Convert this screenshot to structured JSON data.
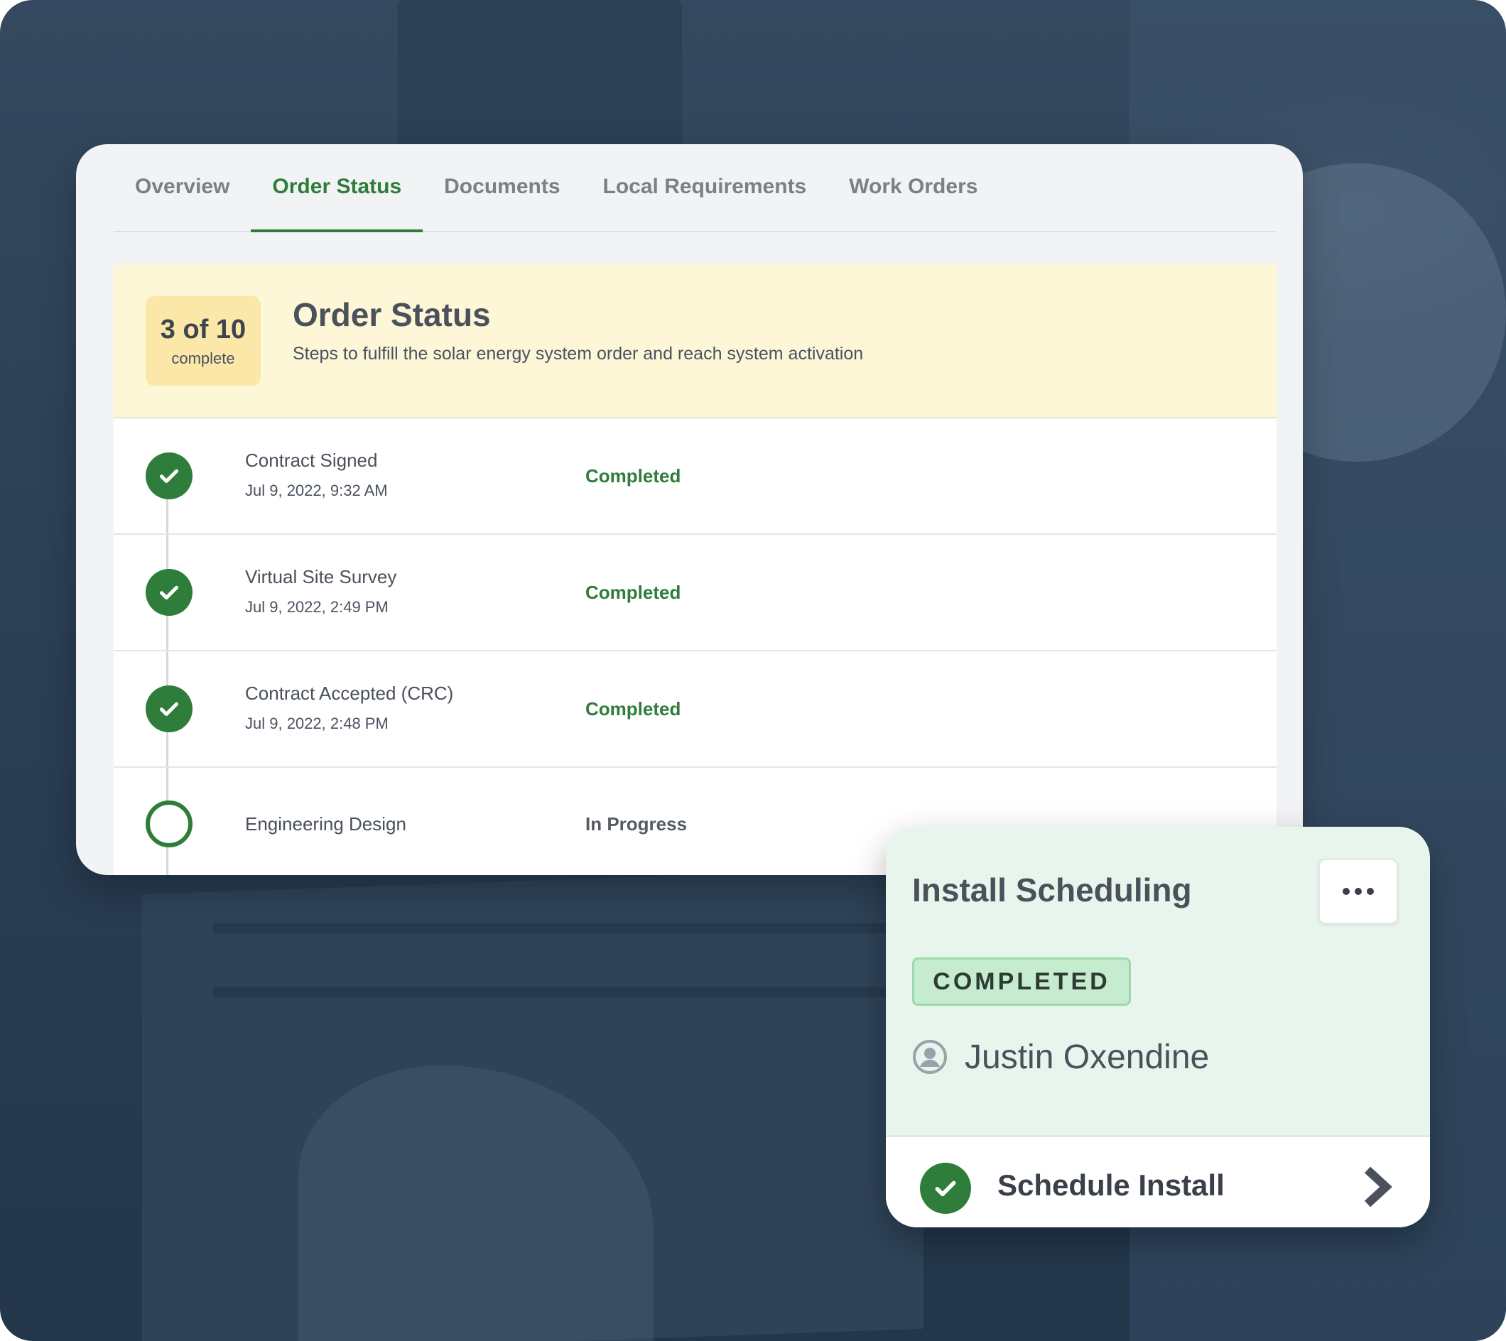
{
  "tabs": [
    {
      "label": "Overview",
      "active": false
    },
    {
      "label": "Order Status",
      "active": true
    },
    {
      "label": "Documents",
      "active": false
    },
    {
      "label": "Local Requirements",
      "active": false
    },
    {
      "label": "Work Orders",
      "active": false
    }
  ],
  "order_status": {
    "progress": {
      "count": "3 of 10",
      "label": "complete"
    },
    "title": "Order Status",
    "subtitle": "Steps to fulfill the solar energy system order and reach system activation"
  },
  "steps": [
    {
      "name": "Contract Signed",
      "date": "Jul 9, 2022, 9:32 AM",
      "status": "Completed",
      "icon": "check-circle-icon"
    },
    {
      "name": "Virtual Site Survey",
      "date": "Jul 9, 2022, 2:49 PM",
      "status": "Completed",
      "icon": "check-circle-icon"
    },
    {
      "name": "Contract Accepted (CRC)",
      "date": "Jul 9, 2022, 2:48 PM",
      "status": "Completed",
      "icon": "check-circle-icon"
    },
    {
      "name": "Engineering Design",
      "date": "",
      "status": "In Progress",
      "icon": "empty-circle-icon"
    }
  ],
  "install_card": {
    "title": "Install Scheduling",
    "badge": "COMPLETED",
    "assignee": "Justin Oxendine",
    "action_label": "Schedule Install"
  },
  "colors": {
    "accent_green": "#2f7d3a",
    "banner_yellow": "#fdf7d7",
    "badge_yellow": "#fbe8a8",
    "card_green": "#e8f5ec",
    "badge_green": "#c6ecd0",
    "backdrop": "#2f4358"
  },
  "icons": [
    "check-icon",
    "empty-circle-icon",
    "more-dots-icon",
    "user-icon",
    "chevron-right-icon"
  ]
}
